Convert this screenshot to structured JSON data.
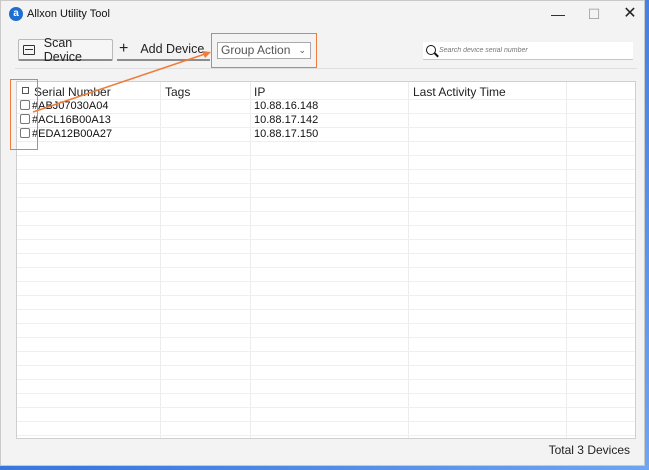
{
  "window": {
    "title": "Allxon Utility Tool",
    "minimize": "—",
    "maximize": "☐",
    "close": "✕"
  },
  "toolbar": {
    "scan_label": "Scan Device",
    "add_label": "Add Device",
    "group_action": "Group Action",
    "search_placeholder": "Search device serial number"
  },
  "table": {
    "columns": [
      "Serial Number",
      "Tags",
      "IP",
      "Last Activity Time"
    ],
    "rows": [
      {
        "serial": "#ABJ07030A04",
        "tags": "",
        "ip": "10.88.16.148",
        "last_activity": ""
      },
      {
        "serial": "#ACL16B00A13",
        "tags": "",
        "ip": "10.88.17.142",
        "last_activity": ""
      },
      {
        "serial": "#EDA12B00A27",
        "tags": "",
        "ip": "10.88.17.150",
        "last_activity": ""
      }
    ]
  },
  "footer": {
    "total": "Total 3 Devices"
  },
  "colors": {
    "highlight": "#f07b3a",
    "accent": "#1f6fd1"
  }
}
